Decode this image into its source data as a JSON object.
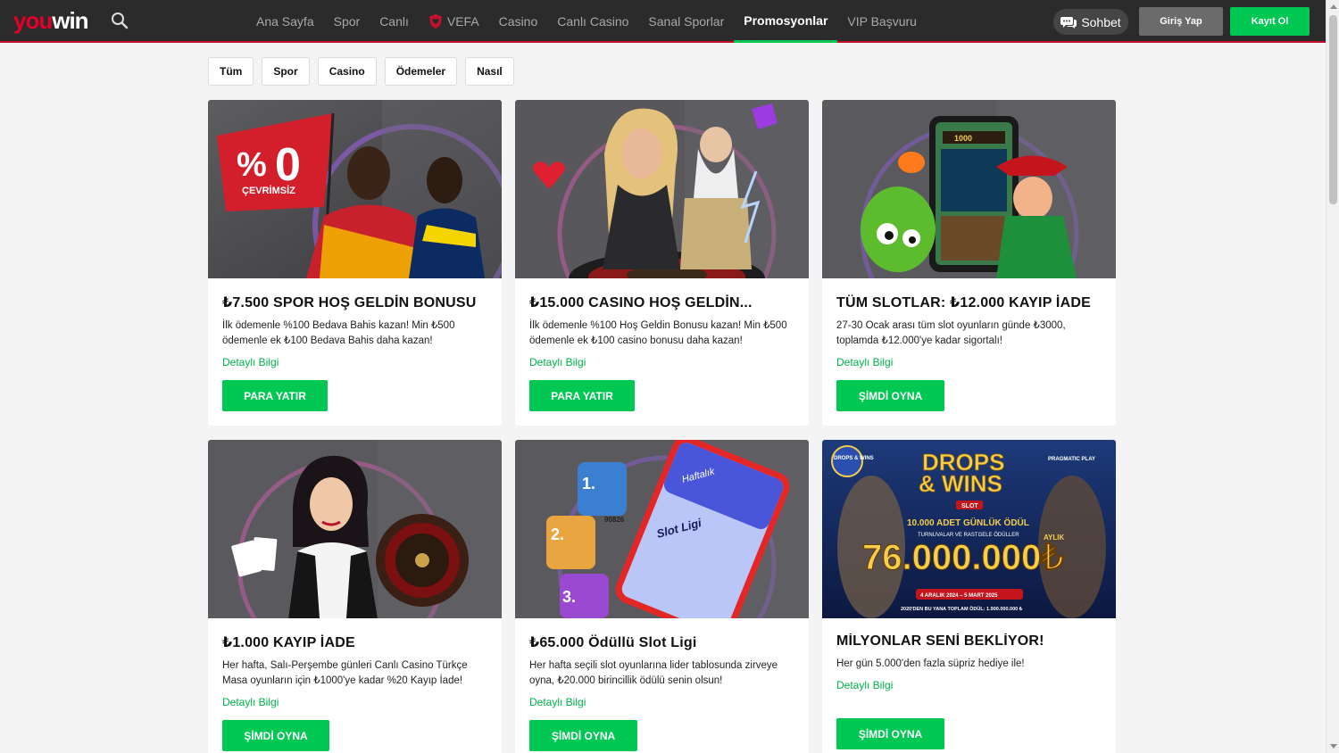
{
  "header": {
    "logo_you": "you",
    "logo_win": "win",
    "nav": [
      "Ana Sayfa",
      "Spor",
      "Canlı",
      "VEFA",
      "Casino",
      "Canlı Casino",
      "Sanal Sporlar",
      "Promosyonlar",
      "VIP Başvuru"
    ],
    "active_nav": "Promosyonlar",
    "chat_label": "Sohbet",
    "login_label": "Giriş Yap",
    "register_label": "Kayıt Ol"
  },
  "filters": [
    "Tüm",
    "Spor",
    "Casino",
    "Ödemeler",
    "Nasıl"
  ],
  "cards": [
    {
      "title": "₺7.500 SPOR HOŞ GELDİN BONUSU",
      "desc": "İlk ödemenle %100 Bedava Bahis kazan! Min ₺500 ödemenle ek ₺100 Bedava Bahis daha kazan!",
      "link": "Detaylı Bilgi",
      "button": "PARA YATIR",
      "image_text": {
        "flag_pct": "%",
        "flag_zero": "0",
        "flag_word": "ÇEVRİMSİZ"
      }
    },
    {
      "title": "₺15.000 CASINO HOŞ GELDİN...",
      "desc": "İlk ödemenle %100 Hoş Geldin Bonusu kazan! Min ₺500 ödemenle ek ₺100 casino bonusu daha kazan!",
      "link": "Detaylı Bilgi",
      "button": "PARA YATIR"
    },
    {
      "title": "TÜM SLOTLAR: ₺12.000 KAYIP İADE",
      "desc": "27-30 Ocak arası tüm slot oyunların günde ₺3000, toplamda ₺12.000'ye kadar sigortalı!",
      "link": "Detaylı Bilgi",
      "button": "ŞİMDİ OYNA",
      "image_text": {
        "phone_amount": "1000"
      }
    },
    {
      "title": "₺1.000 KAYIP İADE",
      "desc": "Her hafta, Salı-Perşembe günleri Canlı Casino Türkçe Masa oyunların için ₺1000'ye kadar %20 Kayıp İade!",
      "link": "Detaylı Bilgi",
      "button": "ŞİMDİ OYNA"
    },
    {
      "title": "₺65.000 Ödüllü Slot Ligi",
      "desc": "Her hafta seçili slot oyunlarına lider tablosunda zirveye oyna, ₺20.000 birincillik ödülü senin olsun!",
      "link": "Detaylı Bilgi",
      "button": "ŞİMDİ OYNA",
      "image_text": {
        "weekly": "Haftalık",
        "league": "Slot Ligi",
        "rank1": "1.",
        "rank2": "2.",
        "rank3": "3.",
        "score": "90826"
      }
    },
    {
      "title": "MİLYONLAR SENİ BEKLİYOR!",
      "desc": "Her gün 5.000'den fazla süpriz hediye ile!",
      "link": "Detaylı Bilgi",
      "button": "ŞİMDİ OYNA",
      "image_text": {
        "drops": "DROPS",
        "wins": "& WINS",
        "slot": "SLOT",
        "daily": "10.000 ADET GÜNLÜK ÖDÜL",
        "sub": "TURNUVALAR VE RASTGELE ÖDÜLLER",
        "monthly": "AYLIK",
        "amount": "76.000.000₺",
        "dates": "4 ARALIK 2024 – 5 MART 2025",
        "total": "2020'DEN BU YANA TOPLAM ÖDÜL: 1.900.000.000 ₺",
        "badge": "DROPS & WINS",
        "provider": "PRAGMATIC PLAY"
      }
    }
  ],
  "colors": {
    "brand_red": "#e4002b",
    "accent_green": "#00c853",
    "header_bg": "#2b2b2b"
  }
}
